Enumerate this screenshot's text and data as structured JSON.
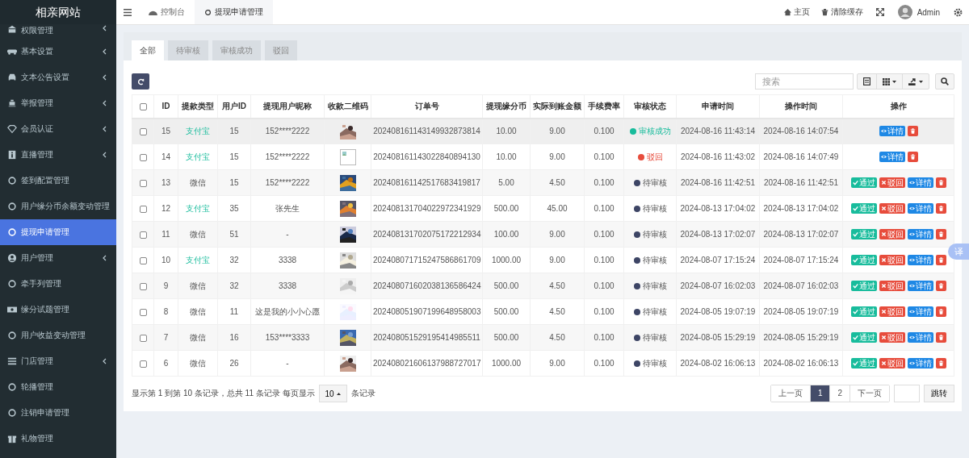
{
  "sidebar": {
    "logo": "相亲网站",
    "items": [
      {
        "label": "权限管理",
        "expandable": true,
        "selected": false
      },
      {
        "label": "基本设置",
        "expandable": true,
        "selected": false
      },
      {
        "label": "文本公告设置",
        "expandable": true,
        "selected": false
      },
      {
        "label": "举报管理",
        "expandable": true,
        "selected": false
      },
      {
        "label": "会员认证",
        "expandable": true,
        "selected": false
      },
      {
        "label": "直播管理",
        "expandable": true,
        "selected": false
      },
      {
        "label": "签到配置管理",
        "expandable": false,
        "selected": false
      },
      {
        "label": "用户缘分币余额变动管理",
        "expandable": false,
        "selected": false
      },
      {
        "label": "提现申请管理",
        "expandable": false,
        "selected": true
      },
      {
        "label": "用户管理",
        "expandable": true,
        "selected": false
      },
      {
        "label": "牵手列管理",
        "expandable": false,
        "selected": false
      },
      {
        "label": "缘分试题管理",
        "expandable": false,
        "selected": false
      },
      {
        "label": "用户收益变动管理",
        "expandable": false,
        "selected": false
      },
      {
        "label": "门店管理",
        "expandable": true,
        "selected": false
      },
      {
        "label": "轮播管理",
        "expandable": false,
        "selected": false
      },
      {
        "label": "注销申请管理",
        "expandable": false,
        "selected": false
      },
      {
        "label": "礼物管理",
        "expandable": false,
        "selected": false
      }
    ]
  },
  "topbar": {
    "tabs": [
      {
        "label": "控制台",
        "selected": false
      },
      {
        "label": "提现申请管理",
        "selected": true
      }
    ],
    "links": [
      {
        "label": "主页"
      },
      {
        "label": "清除缓存"
      }
    ],
    "user": "Admin"
  },
  "filter_tabs": [
    {
      "label": "全部",
      "selected": true
    },
    {
      "label": "待审核",
      "selected": false
    },
    {
      "label": "审核成功",
      "selected": false
    },
    {
      "label": "驳回",
      "selected": false
    }
  ],
  "search": {
    "placeholder": "搜索"
  },
  "table": {
    "header_checked": false,
    "columns": [
      "ID",
      "提款类型",
      "用户ID",
      "提现用户昵称",
      "收款二维码",
      "订单号",
      "提现缘分币",
      "实际到账金额",
      "手续费率",
      "审核状态",
      "申请时间",
      "操作时间",
      "操作"
    ],
    "rows": [
      {
        "checked": false,
        "id": "15",
        "pay_type": {
          "text": "支付宝",
          "highlight": true
        },
        "user_id": "15",
        "nickname": "152****2222",
        "order": "202408161143149932873814",
        "coins": "10.00",
        "amount": "9.00",
        "fee": "0.100",
        "status": {
          "text": "审核成功",
          "kind": "success"
        },
        "applied": "2024-08-16 11:43:14",
        "operated": "2024-08-16 14:07:54",
        "actions": [
          {
            "kind": "detail",
            "label": "详情"
          },
          {
            "kind": "delete"
          }
        ]
      },
      {
        "checked": false,
        "id": "14",
        "pay_type": {
          "text": "支付宝",
          "highlight": true
        },
        "user_id": "15",
        "nickname": "152****2222",
        "qr": {
          "kind": "broken"
        },
        "order": "202408161143022840894130",
        "coins": "10.00",
        "amount": "9.00",
        "fee": "0.100",
        "status": {
          "text": "驳回",
          "kind": "rejected"
        },
        "applied": "2024-08-16 11:43:02",
        "operated": "2024-08-16 14:07:49",
        "actions": [
          {
            "kind": "detail",
            "label": "详情"
          },
          {
            "kind": "delete"
          }
        ]
      },
      {
        "checked": false,
        "id": "13",
        "pay_type": {
          "text": "微信",
          "highlight": false
        },
        "user_id": "15",
        "nickname": "152****2222",
        "order": "202408161142517683419817",
        "coins": "5.00",
        "amount": "4.50",
        "fee": "0.100",
        "status": {
          "text": "待审核",
          "kind": "pending"
        },
        "applied": "2024-08-16 11:42:51",
        "operated": "2024-08-16 11:42:51",
        "actions": [
          {
            "kind": "approve",
            "label": "通过"
          },
          {
            "kind": "reject",
            "label": "驳回"
          },
          {
            "kind": "detail",
            "label": "详情"
          },
          {
            "kind": "delete"
          }
        ]
      },
      {
        "checked": false,
        "id": "12",
        "pay_type": {
          "text": "支付宝",
          "highlight": true
        },
        "user_id": "35",
        "nickname": "张先生",
        "order": "202408131704022972341929",
        "coins": "500.00",
        "amount": "45.00",
        "fee": "0.100",
        "status": {
          "text": "待审核",
          "kind": "pending"
        },
        "applied": "2024-08-13 17:04:02",
        "operated": "2024-08-13 17:04:02",
        "actions": [
          {
            "kind": "approve",
            "label": "通过"
          },
          {
            "kind": "reject",
            "label": "驳回"
          },
          {
            "kind": "detail",
            "label": "详情"
          },
          {
            "kind": "delete"
          }
        ]
      },
      {
        "checked": false,
        "id": "11",
        "pay_type": {
          "text": "微信",
          "highlight": false
        },
        "user_id": "51",
        "nickname": "-",
        "order": "202408131702075172212934",
        "coins": "100.00",
        "amount": "9.00",
        "fee": "0.100",
        "status": {
          "text": "待审核",
          "kind": "pending"
        },
        "applied": "2024-08-13 17:02:07",
        "operated": "2024-08-13 17:02:07",
        "actions": [
          {
            "kind": "approve",
            "label": "通过"
          },
          {
            "kind": "reject",
            "label": "驳回"
          },
          {
            "kind": "detail",
            "label": "详情"
          },
          {
            "kind": "delete"
          }
        ]
      },
      {
        "checked": false,
        "id": "10",
        "pay_type": {
          "text": "支付宝",
          "highlight": true
        },
        "user_id": "32",
        "nickname": "3338",
        "order": "202408071715247586861709",
        "coins": "1000.00",
        "amount": "9.00",
        "fee": "0.100",
        "status": {
          "text": "待审核",
          "kind": "pending"
        },
        "applied": "2024-08-07 17:15:24",
        "operated": "2024-08-07 17:15:24",
        "actions": [
          {
            "kind": "approve",
            "label": "通过"
          },
          {
            "kind": "reject",
            "label": "驳回"
          },
          {
            "kind": "detail",
            "label": "详情"
          },
          {
            "kind": "delete"
          }
        ]
      },
      {
        "checked": false,
        "id": "9",
        "pay_type": {
          "text": "微信",
          "highlight": false
        },
        "user_id": "32",
        "nickname": "3338",
        "order": "202408071602038136586424",
        "coins": "500.00",
        "amount": "4.50",
        "fee": "0.100",
        "status": {
          "text": "待审核",
          "kind": "pending"
        },
        "applied": "2024-08-07 16:02:03",
        "operated": "2024-08-07 16:02:03",
        "actions": [
          {
            "kind": "approve",
            "label": "通过"
          },
          {
            "kind": "reject",
            "label": "驳回"
          },
          {
            "kind": "detail",
            "label": "详情"
          },
          {
            "kind": "delete"
          }
        ]
      },
      {
        "checked": false,
        "id": "8",
        "pay_type": {
          "text": "微信",
          "highlight": false
        },
        "user_id": "11",
        "nickname": "这是我的小小心愿",
        "order": "202408051907199648958003",
        "coins": "500.00",
        "amount": "4.50",
        "fee": "0.100",
        "status": {
          "text": "待审核",
          "kind": "pending"
        },
        "applied": "2024-08-05 19:07:19",
        "operated": "2024-08-05 19:07:19",
        "actions": [
          {
            "kind": "approve",
            "label": "通过"
          },
          {
            "kind": "reject",
            "label": "驳回"
          },
          {
            "kind": "detail",
            "label": "详情"
          },
          {
            "kind": "delete"
          }
        ]
      },
      {
        "checked": false,
        "id": "7",
        "pay_type": {
          "text": "微信",
          "highlight": false
        },
        "user_id": "16",
        "nickname": "153****3333",
        "order": "202408051529195414985511",
        "coins": "500.00",
        "amount": "4.50",
        "fee": "0.100",
        "status": {
          "text": "待审核",
          "kind": "pending"
        },
        "applied": "2024-08-05 15:29:19",
        "operated": "2024-08-05 15:29:19",
        "actions": [
          {
            "kind": "approve",
            "label": "通过"
          },
          {
            "kind": "reject",
            "label": "驳回"
          },
          {
            "kind": "detail",
            "label": "详情"
          },
          {
            "kind": "delete"
          }
        ]
      },
      {
        "checked": false,
        "id": "6",
        "pay_type": {
          "text": "微信",
          "highlight": false
        },
        "user_id": "26",
        "nickname": "-",
        "order": "202408021606137988727017",
        "coins": "1000.00",
        "amount": "9.00",
        "fee": "0.100",
        "status": {
          "text": "待审核",
          "kind": "pending"
        },
        "applied": "2024-08-02 16:06:13",
        "operated": "2024-08-02 16:06:13",
        "actions": [
          {
            "kind": "approve",
            "label": "通过"
          },
          {
            "kind": "reject",
            "label": "驳回"
          },
          {
            "kind": "detail",
            "label": "详情"
          },
          {
            "kind": "delete"
          }
        ]
      }
    ]
  },
  "pagination": {
    "info": "显示第 1 到第 10 条记录，总共 11 条记录 每页显示",
    "page_size": "10",
    "page_size_suffix": "条记录",
    "pages": [
      {
        "label": "上一页",
        "selected": false
      },
      {
        "label": "1",
        "selected": true
      },
      {
        "label": "2",
        "selected": false
      },
      {
        "label": "下一页",
        "selected": false
      }
    ],
    "jump": "跳转"
  },
  "translate_button": "译"
}
